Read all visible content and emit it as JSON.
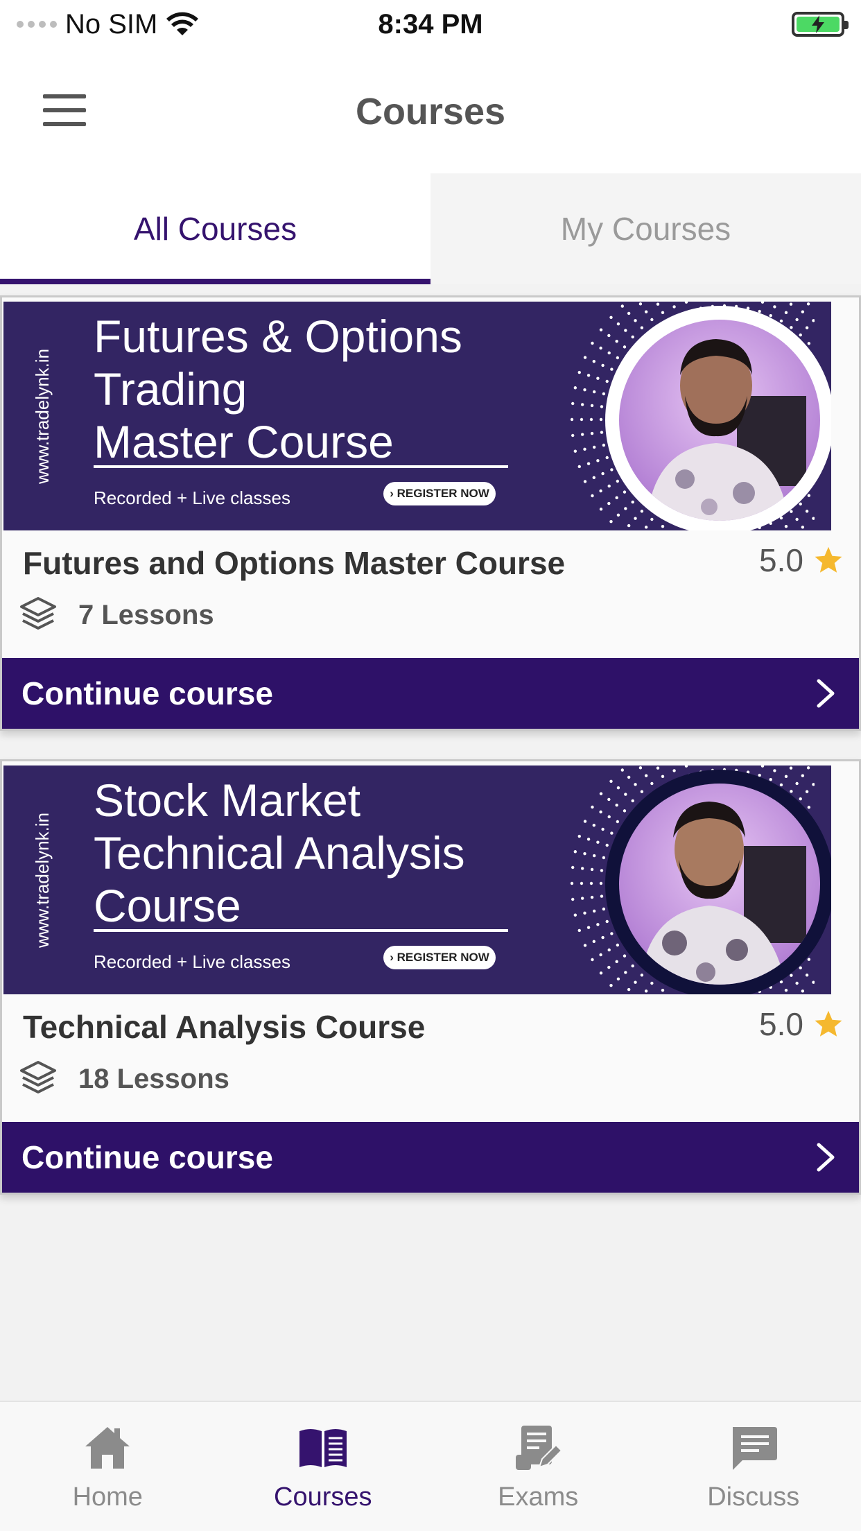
{
  "status_bar": {
    "carrier": "No SIM",
    "time": "8:34 PM"
  },
  "header": {
    "title": "Courses",
    "menu_icon": "hamburger-menu-icon"
  },
  "tabs": [
    {
      "label": "All Courses",
      "active": true
    },
    {
      "label": "My Courses",
      "active": false
    }
  ],
  "courses": [
    {
      "banner": {
        "site": "www.tradelynk.in",
        "title_lines": [
          "Futures & Options",
          "Trading",
          "Master Course"
        ],
        "subtitle": "Recorded + Live classes",
        "register": "› REGISTER NOW"
      },
      "title": "Futures and Options Master Course",
      "rating": "5.0",
      "lessons": "7 Lessons",
      "action": "Continue course"
    },
    {
      "banner": {
        "site": "www.tradelynk.in",
        "title_lines": [
          "Stock Market",
          "Technical Analysis",
          "Course"
        ],
        "subtitle": "Recorded + Live classes",
        "register": "› REGISTER NOW"
      },
      "title": "Technical Analysis Course",
      "rating": "5.0",
      "lessons": "18 Lessons",
      "action": "Continue course"
    }
  ],
  "bottom_nav": [
    {
      "label": "Home",
      "icon": "home-icon",
      "active": false
    },
    {
      "label": "Courses",
      "icon": "book-icon",
      "active": true
    },
    {
      "label": "Exams",
      "icon": "exam-icon",
      "active": false
    },
    {
      "label": "Discuss",
      "icon": "chat-icon",
      "active": false
    }
  ],
  "colors": {
    "primary": "#35136e",
    "button": "#2e1168",
    "banner": "#332563",
    "star": "#f5b82e",
    "inactive": "#8b8b8b"
  }
}
